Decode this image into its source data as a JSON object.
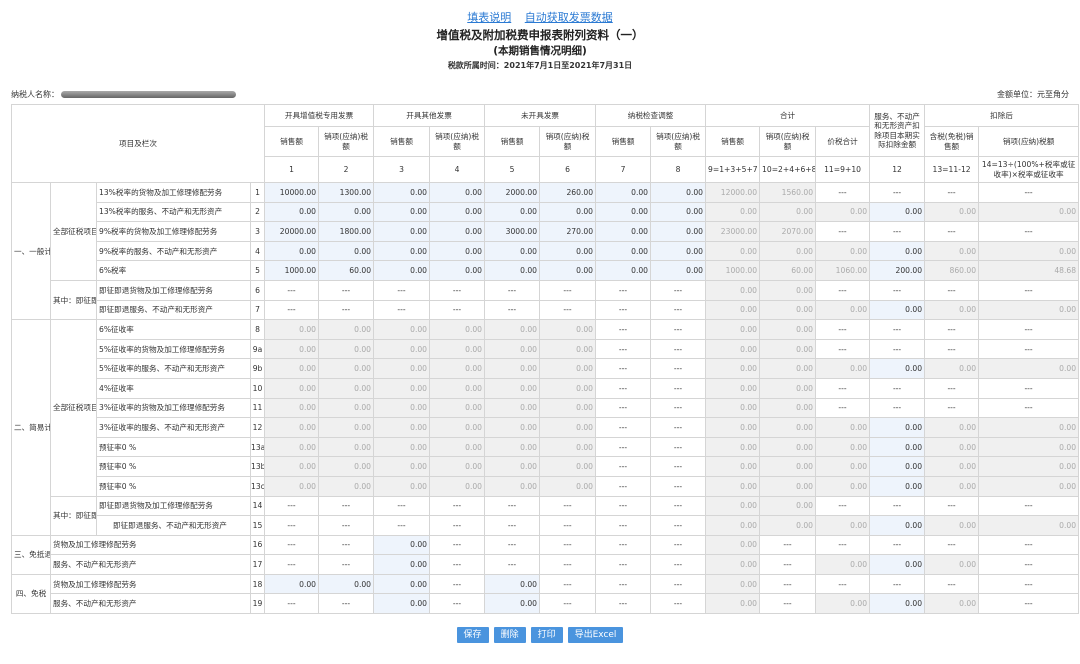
{
  "links": {
    "fill_instructions": "填表说明",
    "auto_fetch": "自动获取发票数据"
  },
  "title": "增值税及附加税费申报表附列资料（一）",
  "subtitle": "(本期销售情况明细)",
  "period": "税款所属时间：2021年7月1日至2021年7月31日",
  "taxpayer_label": "纳税人名称：",
  "unit": "金额单位：元至角分",
  "header": {
    "item_label": "项目及栏次",
    "group_vat_special": "开具增值税专用发票",
    "group_other": "开具其他发票",
    "group_no_invoice": "未开具发票",
    "group_inspection": "纳税检查调整",
    "group_total": "合计",
    "service_deduct": "服务、不动产和无形资产扣除项目本期实际扣除金额",
    "group_after": "扣除后",
    "sales": "销售额",
    "output_tax": "销项(应纳)税额",
    "output_tax_b": "销项(应纳)税额",
    "price_tax_total": "价税合计",
    "taxinc_sales": "含税(免税)销售额",
    "nums": [
      "1",
      "2",
      "3",
      "4",
      "5",
      "6",
      "7",
      "8",
      "9=1+3+5+7",
      "10=2+4+6+8",
      "11=9+10",
      "12",
      "13=11-12",
      "14=13÷(100%+税率或征收率)×税率或征收率"
    ]
  },
  "groups": {
    "general": "一、一般计税方法计税",
    "simple": "二、简易计税方法计税",
    "exempt_refund": "三、免抵退税",
    "exempt": "四、免税",
    "all_items": "全部征税项目",
    "instant_refund": "其中：即征即退项目"
  },
  "rows": [
    {
      "item": "13%税率的货物及加工修理修配劳务",
      "line": "1",
      "cells": [
        "10000.00",
        "1300.00",
        "0.00",
        "0.00",
        "2000.00",
        "260.00",
        "0.00",
        "0.00",
        "12000.00",
        "1560.00",
        "---",
        "---",
        "---",
        "---"
      ]
    },
    {
      "item": "13%税率的服务、不动产和无形资产",
      "line": "2",
      "cells": [
        "0.00",
        "0.00",
        "0.00",
        "0.00",
        "0.00",
        "0.00",
        "0.00",
        "0.00",
        "0.00",
        "0.00",
        "0.00",
        "0.00",
        "0.00",
        "0.00"
      ]
    },
    {
      "item": "9%税率的货物及加工修理修配劳务",
      "line": "3",
      "cells": [
        "20000.00",
        "1800.00",
        "0.00",
        "0.00",
        "3000.00",
        "270.00",
        "0.00",
        "0.00",
        "23000.00",
        "2070.00",
        "---",
        "---",
        "---",
        "---"
      ]
    },
    {
      "item": "9%税率的服务、不动产和无形资产",
      "line": "4",
      "cells": [
        "0.00",
        "0.00",
        "0.00",
        "0.00",
        "0.00",
        "0.00",
        "0.00",
        "0.00",
        "0.00",
        "0.00",
        "0.00",
        "0.00",
        "0.00",
        "0.00"
      ]
    },
    {
      "item": "6%税率",
      "line": "5",
      "cells": [
        "1000.00",
        "60.00",
        "0.00",
        "0.00",
        "0.00",
        "0.00",
        "0.00",
        "0.00",
        "1000.00",
        "60.00",
        "1060.00",
        "200.00",
        "860.00",
        "48.68"
      ]
    },
    {
      "item": "即征即退货物及加工修理修配劳务",
      "line": "6",
      "cells": [
        "---",
        "---",
        "---",
        "---",
        "---",
        "---",
        "---",
        "---",
        "0.00",
        "0.00",
        "---",
        "---",
        "---",
        "---"
      ]
    },
    {
      "item": "即征即退服务、不动产和无形资产",
      "line": "7",
      "cells": [
        "---",
        "---",
        "---",
        "---",
        "---",
        "---",
        "---",
        "---",
        "0.00",
        "0.00",
        "0.00",
        "0.00",
        "0.00",
        "0.00"
      ]
    },
    {
      "item": "6%征收率",
      "line": "8",
      "cells": [
        "0.00",
        "0.00",
        "0.00",
        "0.00",
        "0.00",
        "0.00",
        "---",
        "---",
        "0.00",
        "0.00",
        "---",
        "---",
        "---",
        "---"
      ]
    },
    {
      "item": "5%征收率的货物及加工修理修配劳务",
      "line": "9a",
      "cells": [
        "0.00",
        "0.00",
        "0.00",
        "0.00",
        "0.00",
        "0.00",
        "---",
        "---",
        "0.00",
        "0.00",
        "---",
        "---",
        "---",
        "---"
      ]
    },
    {
      "item": "5%征收率的服务、不动产和无形资产",
      "line": "9b",
      "cells": [
        "0.00",
        "0.00",
        "0.00",
        "0.00",
        "0.00",
        "0.00",
        "---",
        "---",
        "0.00",
        "0.00",
        "0.00",
        "0.00",
        "0.00",
        "0.00"
      ]
    },
    {
      "item": "4%征收率",
      "line": "10",
      "cells": [
        "0.00",
        "0.00",
        "0.00",
        "0.00",
        "0.00",
        "0.00",
        "---",
        "---",
        "0.00",
        "0.00",
        "---",
        "---",
        "---",
        "---"
      ]
    },
    {
      "item": "3%征收率的货物及加工修理修配劳务",
      "line": "11",
      "cells": [
        "0.00",
        "0.00",
        "0.00",
        "0.00",
        "0.00",
        "0.00",
        "---",
        "---",
        "0.00",
        "0.00",
        "---",
        "---",
        "---",
        "---"
      ]
    },
    {
      "item": "3%征收率的服务、不动产和无形资产",
      "line": "12",
      "cells": [
        "0.00",
        "0.00",
        "0.00",
        "0.00",
        "0.00",
        "0.00",
        "---",
        "---",
        "0.00",
        "0.00",
        "0.00",
        "0.00",
        "0.00",
        "0.00"
      ]
    },
    {
      "item": "预征率0 %",
      "line": "13a",
      "cells": [
        "0.00",
        "0.00",
        "0.00",
        "0.00",
        "0.00",
        "0.00",
        "---",
        "---",
        "0.00",
        "0.00",
        "0.00",
        "0.00",
        "0.00",
        "0.00"
      ]
    },
    {
      "item": "预征率0 %",
      "line": "13b",
      "cells": [
        "0.00",
        "0.00",
        "0.00",
        "0.00",
        "0.00",
        "0.00",
        "---",
        "---",
        "0.00",
        "0.00",
        "0.00",
        "0.00",
        "0.00",
        "0.00"
      ]
    },
    {
      "item": "预征率0 %",
      "line": "13c",
      "cells": [
        "0.00",
        "0.00",
        "0.00",
        "0.00",
        "0.00",
        "0.00",
        "---",
        "---",
        "0.00",
        "0.00",
        "0.00",
        "0.00",
        "0.00",
        "0.00"
      ]
    },
    {
      "item": "即征即退货物及加工修理修配劳务",
      "line": "14",
      "cells": [
        "---",
        "---",
        "---",
        "---",
        "---",
        "---",
        "---",
        "---",
        "0.00",
        "0.00",
        "---",
        "---",
        "---",
        "---"
      ]
    },
    {
      "item": "即征即退服务、不动产和无形资产",
      "line": "15",
      "cells": [
        "---",
        "---",
        "---",
        "---",
        "---",
        "---",
        "---",
        "---",
        "0.00",
        "0.00",
        "0.00",
        "0.00",
        "0.00",
        "0.00"
      ]
    },
    {
      "item": "货物及加工修理修配劳务",
      "line": "16",
      "cells": [
        "---",
        "---",
        "0.00",
        "---",
        "---",
        "---",
        "---",
        "---",
        "0.00",
        "---",
        "---",
        "---",
        "---",
        "---"
      ]
    },
    {
      "item": "服务、不动产和无形资产",
      "line": "17",
      "cells": [
        "---",
        "---",
        "0.00",
        "---",
        "---",
        "---",
        "---",
        "---",
        "0.00",
        "---",
        "0.00",
        "0.00",
        "0.00",
        "---"
      ]
    },
    {
      "item": "货物及加工修理修配劳务",
      "line": "18",
      "cells": [
        "0.00",
        "0.00",
        "0.00",
        "---",
        "0.00",
        "---",
        "---",
        "---",
        "0.00",
        "---",
        "---",
        "---",
        "---",
        "---"
      ]
    },
    {
      "item": "服务、不动产和无形资产",
      "line": "19",
      "cells": [
        "---",
        "---",
        "0.00",
        "---",
        "0.00",
        "---",
        "---",
        "---",
        "0.00",
        "---",
        "0.00",
        "0.00",
        "0.00",
        "---"
      ]
    }
  ],
  "buttons": {
    "save": "保存",
    "delete": "删除",
    "print": "打印",
    "export": "导出Excel"
  }
}
